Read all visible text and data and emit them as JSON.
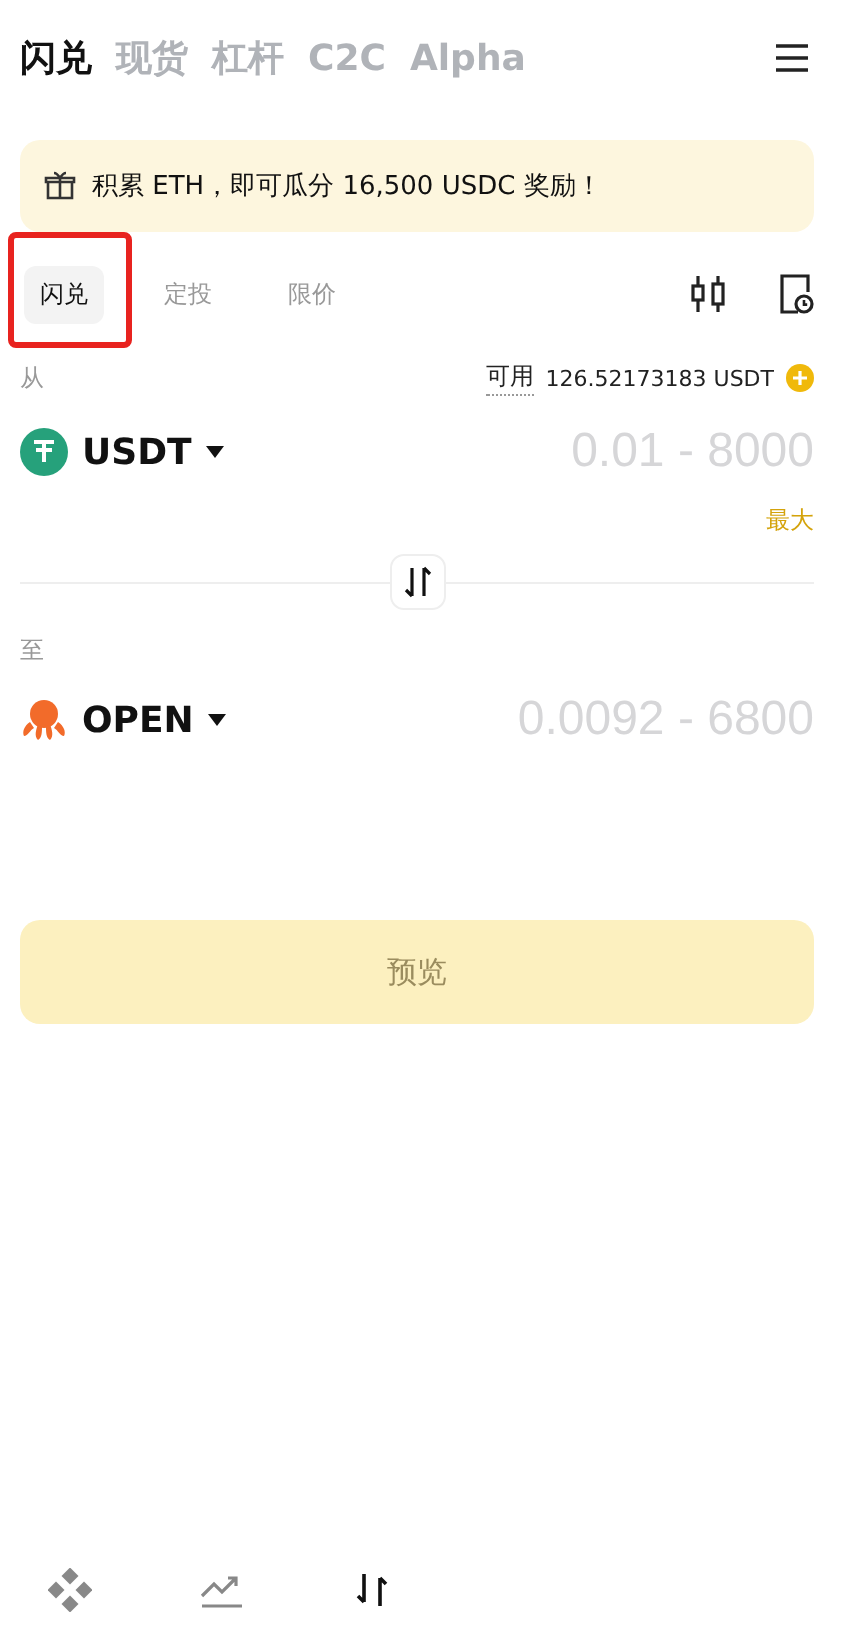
{
  "top_tabs": [
    {
      "label": "闪兑",
      "selected": true
    },
    {
      "label": "现货",
      "selected": false
    },
    {
      "label": "杠杆",
      "selected": false
    },
    {
      "label": "C2C",
      "selected": false
    },
    {
      "label": "Alpha",
      "selected": false
    }
  ],
  "banner": {
    "text": "积累 ETH，即可瓜分 16,500 USDC 奖励！"
  },
  "sub_tabs": [
    {
      "label": "闪兑",
      "selected": true
    },
    {
      "label": "定投",
      "selected": false
    },
    {
      "label": "限价",
      "selected": false
    }
  ],
  "from": {
    "label": "从",
    "available_label": "可用",
    "available_value": "126.52173183 USDT",
    "token": "USDT",
    "placeholder": "0.01 - 8000",
    "max": "最大"
  },
  "to": {
    "label": "至",
    "token": "OPEN",
    "placeholder": "0.0092 - 6800"
  },
  "preview_button": {
    "label": "预览",
    "disabled": true
  }
}
